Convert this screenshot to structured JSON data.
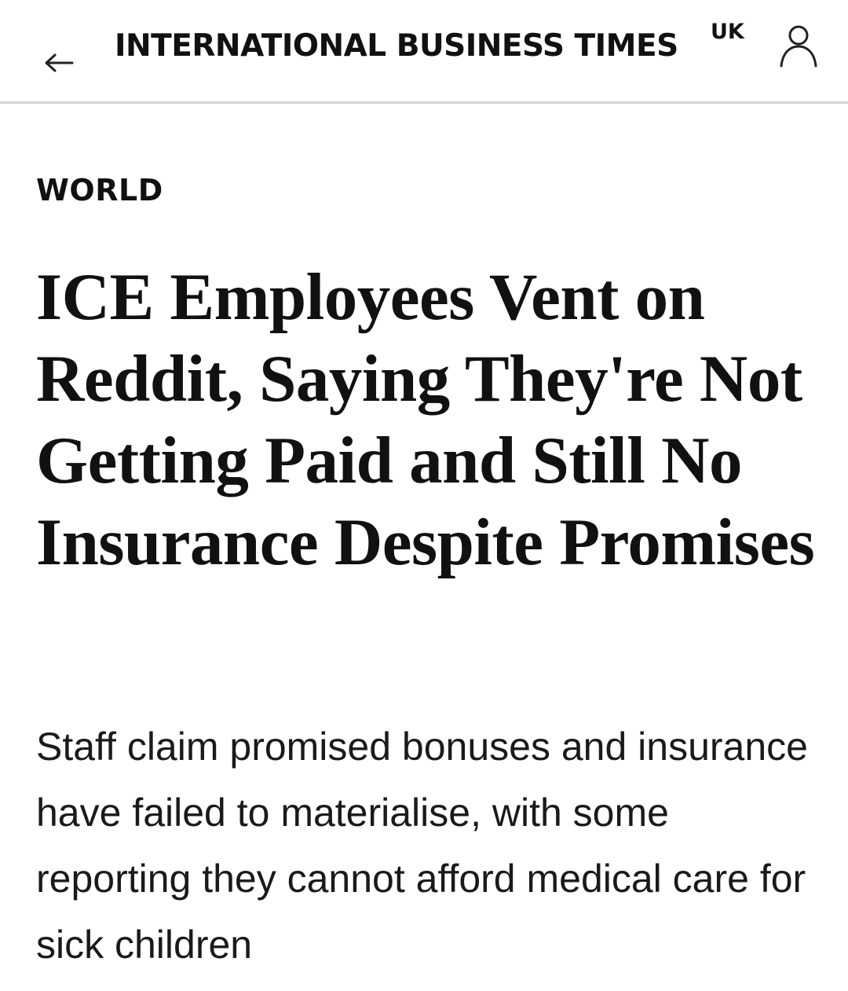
{
  "header": {
    "brand": "INTERNATIONAL BUSINESS TIMES",
    "edition": "UK",
    "back_icon": "left-arrow-icon",
    "account_icon": "user-icon"
  },
  "article": {
    "section": "WORLD",
    "headline": "ICE Employees Vent on Reddit, Saying They're Not Getting Paid and Still No Insurance Despite Promises",
    "standfirst": "Staff claim promised bonuses and insurance have failed to materialise, with some reporting they cannot afford medical care for sick children"
  },
  "colors": {
    "text": "#111111",
    "divider": "#d6d6d6",
    "background": "#ffffff"
  }
}
